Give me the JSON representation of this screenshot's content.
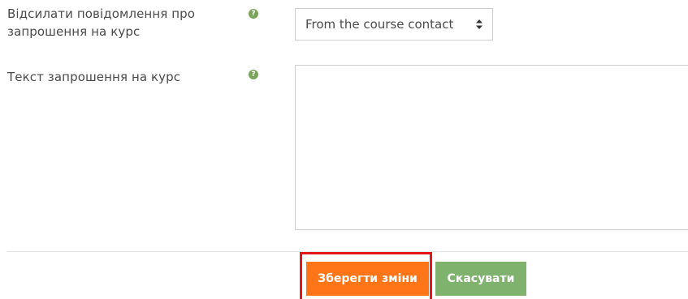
{
  "form": {
    "fields": [
      {
        "label": "Відсилати повідомлення про запрошення на курс",
        "help_icon": "question-circle-icon",
        "control": {
          "type": "select",
          "value": "From the course contact"
        }
      },
      {
        "label": "Текст запрошення на курс",
        "help_icon": "question-circle-icon",
        "control": {
          "type": "textarea",
          "value": ""
        }
      }
    ],
    "buttons": {
      "save_label": "Зберегти зміни",
      "cancel_label": "Скасувати"
    }
  },
  "colors": {
    "help_icon": "#7aa35b",
    "save_button": "#ff7518",
    "cancel_button": "#7fb26c",
    "highlight_border": "#e2161b"
  },
  "help_glyph": "?"
}
